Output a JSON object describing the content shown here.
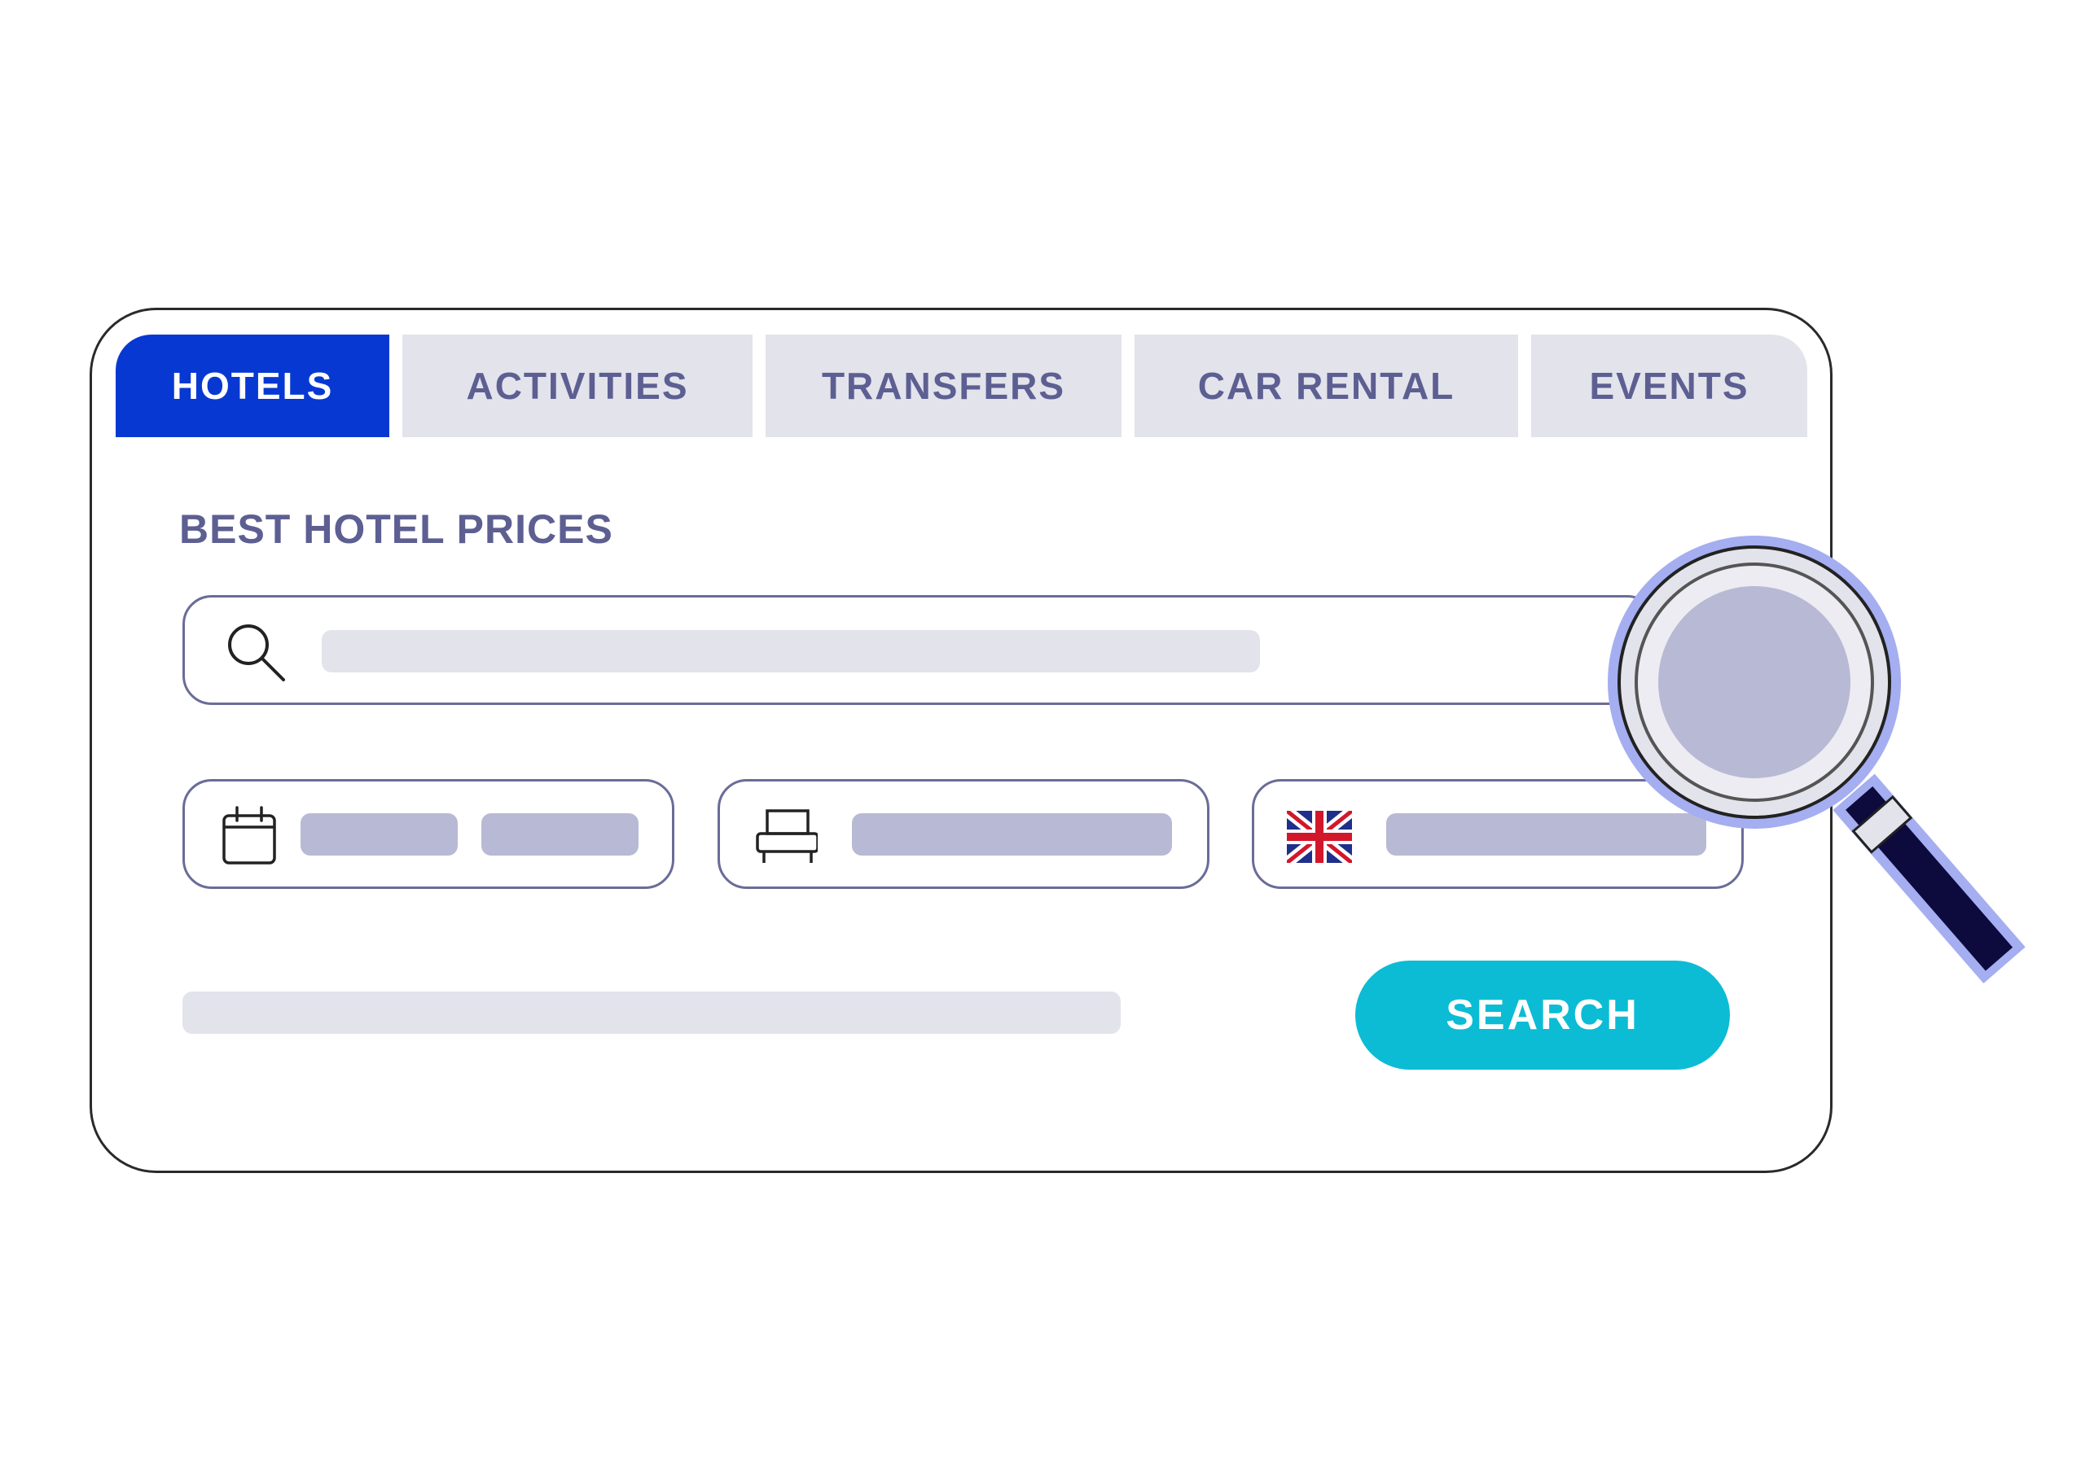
{
  "tabs": [
    {
      "label": "HOTELS",
      "active": true
    },
    {
      "label": "ACTIVITIES",
      "active": false
    },
    {
      "label": "TRANSFERS",
      "active": false
    },
    {
      "label": "CAR RENTAL",
      "active": false
    },
    {
      "label": "EVENTS",
      "active": false
    }
  ],
  "main": {
    "title": "BEST HOTEL PRICES"
  },
  "search": {
    "button_label": "SEARCH"
  },
  "icons": {
    "search": "search-icon",
    "calendar": "calendar-icon",
    "room": "bed-icon",
    "language": "uk-flag-icon",
    "magnifier": "magnifying-glass-icon"
  },
  "colors": {
    "accent_blue": "#0739d2",
    "tab_inactive_bg": "#e3e3ec",
    "tab_text": "#5d5f92",
    "search_button": "#0bbcd4",
    "placeholder_light": "#e3e3ec",
    "placeholder_dark": "#b8b9d4",
    "magnifier_outline": "#a4aef0",
    "magnifier_handle": "#0d0a3d"
  }
}
